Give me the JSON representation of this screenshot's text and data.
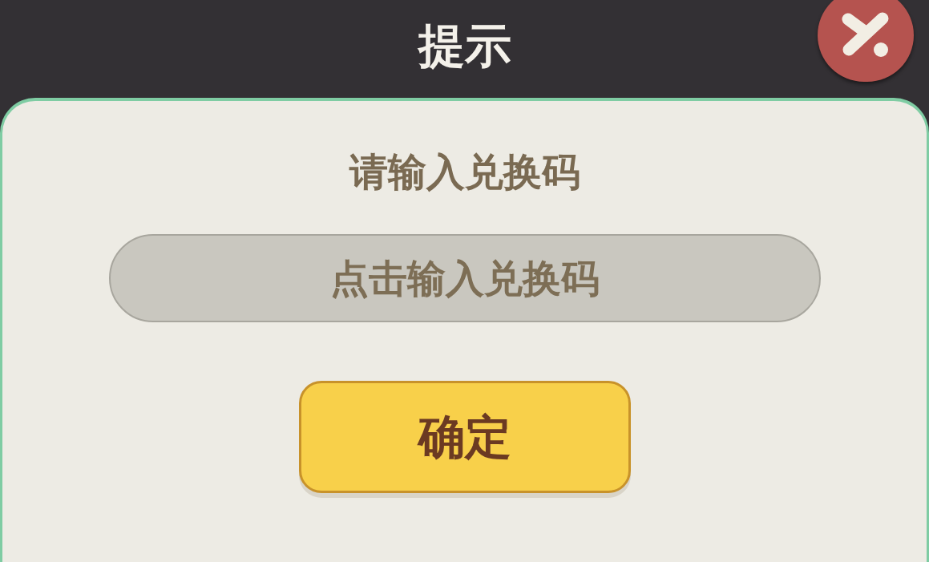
{
  "dialog": {
    "title": "提示",
    "prompt": "请输入兑换码",
    "code_field": {
      "placeholder": "点击输入兑换码"
    },
    "confirm_button": {
      "label": "确定"
    }
  }
}
